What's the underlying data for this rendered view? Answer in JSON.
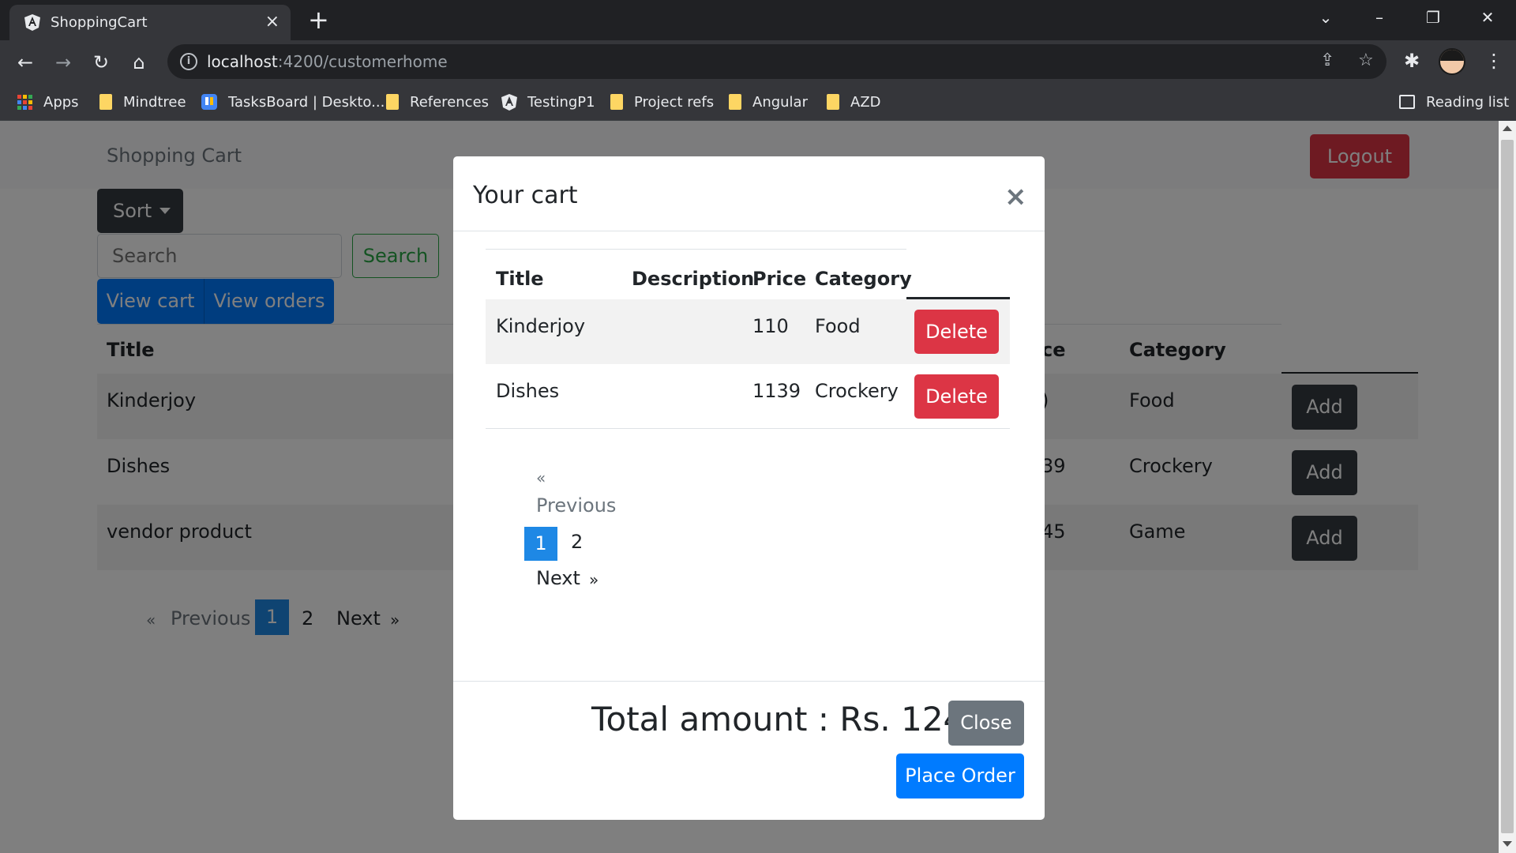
{
  "browser": {
    "tab_title": "ShoppingCart",
    "tab_close": "×",
    "new_tab": "+",
    "url_host": "localhost",
    "url_path": ":4200/customerhome",
    "bookmarks": [
      "Apps",
      "Mindtree",
      "TasksBoard | Deskto...",
      "References",
      "TestingP1",
      "Project refs",
      "Angular",
      "AZD"
    ],
    "reading_list": "Reading list",
    "icons": {
      "back": "←",
      "forward": "→",
      "reload": "↻",
      "home": "⌂",
      "share": "⇪",
      "star": "☆",
      "extensions": "✱",
      "menu": "⋮",
      "minimize": "–",
      "restore": "❐",
      "close": "✕",
      "tab_search": "⌄"
    },
    "colors": {
      "chrome_dark": "#202124",
      "chrome": "#35363a"
    }
  },
  "navbar": {
    "brand": "Shopping Cart",
    "logout": "Logout"
  },
  "controls": {
    "sort": "Sort",
    "search_placeholder": "Search",
    "search_button": "Search",
    "view_cart": "View cart",
    "view_orders": "View orders"
  },
  "product_table": {
    "headers": [
      "Title",
      "ce",
      "Category"
    ],
    "rows": [
      {
        "title": "Kinderjoy",
        "price_fragment": ")",
        "category": "Food",
        "action": "Add"
      },
      {
        "title": "Dishes",
        "price_fragment": "39",
        "category": "Crockery",
        "action": "Add"
      },
      {
        "title": "vendor product",
        "price_fragment": "45",
        "category": "Game",
        "action": "Add"
      }
    ],
    "pager": {
      "prev_symbol": "«",
      "prev": "Previous",
      "page1": "1",
      "page2": "2",
      "next": "Next",
      "next_symbol": "»"
    }
  },
  "modal": {
    "title": "Your cart",
    "close_symbol": "×",
    "headers": [
      "Title",
      "Description",
      "Price",
      "Category"
    ],
    "rows": [
      {
        "title": "Kinderjoy",
        "description": "",
        "price": "110",
        "category": "Food",
        "action": "Delete"
      },
      {
        "title": "Dishes",
        "description": "",
        "price": "1139",
        "category": "Crockery",
        "action": "Delete"
      }
    ],
    "pager": {
      "prev_symbol": "«",
      "prev": "Previous",
      "page1": "1",
      "page2": "2",
      "next": "Next",
      "next_symbol": "»"
    },
    "total": "Total amount : Rs. 1249",
    "close_button": "Close",
    "place_order": "Place Order"
  },
  "theme": {
    "primary": "#007bff",
    "danger": "#dc3545",
    "dark": "#343a40",
    "secondary": "#6c757d",
    "success": "#28a745",
    "active_page": "#1e88e5"
  }
}
